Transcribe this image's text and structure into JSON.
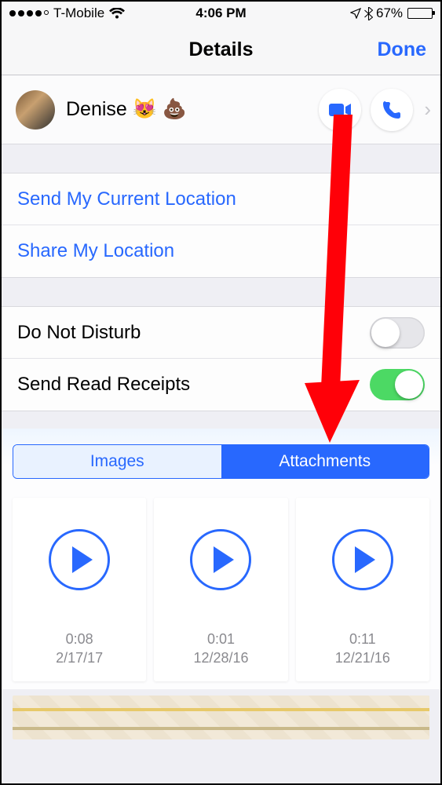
{
  "status": {
    "carrier": "T-Mobile",
    "time": "4:06 PM",
    "battery_pct": "67%",
    "signal_filled": 4,
    "signal_total": 5
  },
  "nav": {
    "title": "Details",
    "done": "Done"
  },
  "contact": {
    "name": "Denise 😻 💩"
  },
  "actions": {
    "send_location": "Send My Current Location",
    "share_location": "Share My Location"
  },
  "settings": {
    "dnd_label": "Do Not Disturb",
    "dnd_on": false,
    "read_receipts_label": "Send Read Receipts",
    "read_receipts_on": true
  },
  "tabs": {
    "images": "Images",
    "attachments": "Attachments",
    "active": "attachments"
  },
  "attachments": [
    {
      "duration": "0:08",
      "date": "2/17/17"
    },
    {
      "duration": "0:01",
      "date": "12/28/16"
    },
    {
      "duration": "0:11",
      "date": "12/21/16"
    }
  ],
  "annotation": {
    "arrow_color": "#ff0008"
  }
}
